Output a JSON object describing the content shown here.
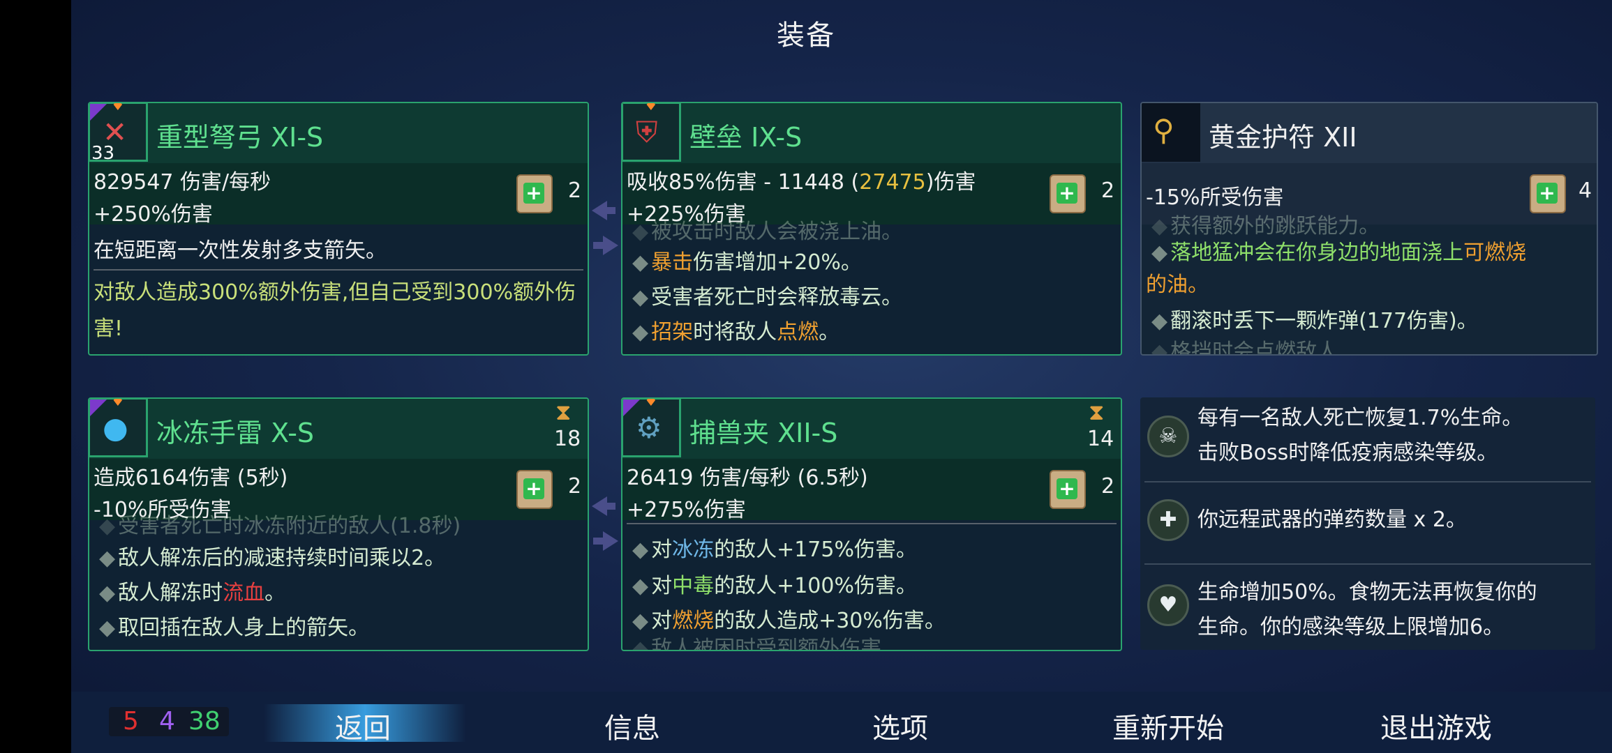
{
  "header": {
    "title": "装备"
  },
  "weapons": [
    {
      "name": "重型弩弓 XI-S",
      "level": "33",
      "stat1": "829547 伤害/每秒",
      "stat2": "+250%伤害",
      "scroll_count": "2",
      "description": "在短距离一次性发射多支箭矢。",
      "effect": "对敌人造成300%额外伤害,但自己受到300%额外伤害!"
    },
    {
      "name": "冰冻手雷 X-S",
      "cooldown": "18",
      "stat1": "造成6164伤害 (5秒)",
      "stat2": "-10%所受伤害",
      "scroll_count": "2",
      "partial_line": "受害者死亡时冰冻附近的敌人(1.8秒)",
      "lines": [
        {
          "a": "敌人解冻后的减速持续时间乘以2。"
        },
        {
          "a": "敌人解冻时",
          "b": "流血",
          "c": "。"
        },
        {
          "a": "取回插在敌人身上的箭矢。"
        }
      ]
    }
  ],
  "secondary": [
    {
      "name": "壁垒 IX-S",
      "stat1_a": "吸收85%伤害 - 11448 (",
      "stat1_b": "27475",
      "stat1_c": ")伤害",
      "stat2": "+225%伤害",
      "scroll_count": "2",
      "partial_line": "被攻击时敌人会被浇上油。",
      "lines": [
        {
          "a": "暴击",
          "b": "伤害增加+20%。"
        },
        {
          "a": "受害者死亡时会释放毒云。"
        },
        {
          "a": "招架",
          "b": "时将敌人",
          "c": "点燃",
          "d": "。"
        }
      ]
    },
    {
      "name": "捕兽夹 XII-S",
      "cooldown": "14",
      "stat1": "26419 伤害/每秒 (6.5秒)",
      "stat2": "+275%伤害",
      "scroll_count": "2",
      "lines": [
        {
          "a": "对",
          "b": "冰冻",
          "c": "的敌人+175%伤害。"
        },
        {
          "a": "对",
          "b": "中毒",
          "c": "的敌人+100%伤害。"
        },
        {
          "a": "对",
          "b": "燃烧",
          "c": "的敌人造成+30%伤害。"
        }
      ],
      "partial_bottom": "敌人被困时受到额外伤害"
    }
  ],
  "amulet": {
    "name": "黄金护符 XII",
    "stat1": "-15%所受伤害",
    "scroll_count": "4",
    "partial_top": "获得额外的跳跃能力。",
    "line1_a": "落地猛冲会在你身边的地面浇上",
    "line1_b": "可燃烧",
    "line1_c": "的油。",
    "line2": "翻滚时丢下一颗炸弹(177伤害)。",
    "partial_bottom": "格挡时会点燃敌人"
  },
  "mutations": [
    {
      "icon": "fang",
      "line1": "每有一名敌人死亡恢复1.7%生命。",
      "line2": "击败Boss时降低疫病感染等级。"
    },
    {
      "icon": "ammo",
      "line1": "你远程武器的弹药数量 x 2。"
    },
    {
      "icon": "vitality",
      "line1": "生命增加50%。食物无法再恢复你的",
      "line2": "生命。你的感染等级上限增加6。"
    }
  ],
  "footer": {
    "scrolls": {
      "red": "5",
      "purple": "4",
      "green": "38"
    },
    "menu": [
      "返回",
      "信息",
      "选项",
      "重新开始",
      "退出游戏"
    ]
  },
  "colors": {
    "accent_green": "#2aa36e",
    "orange": "#f0a030",
    "red": "#e84040",
    "blue": "#6fb8e8"
  }
}
